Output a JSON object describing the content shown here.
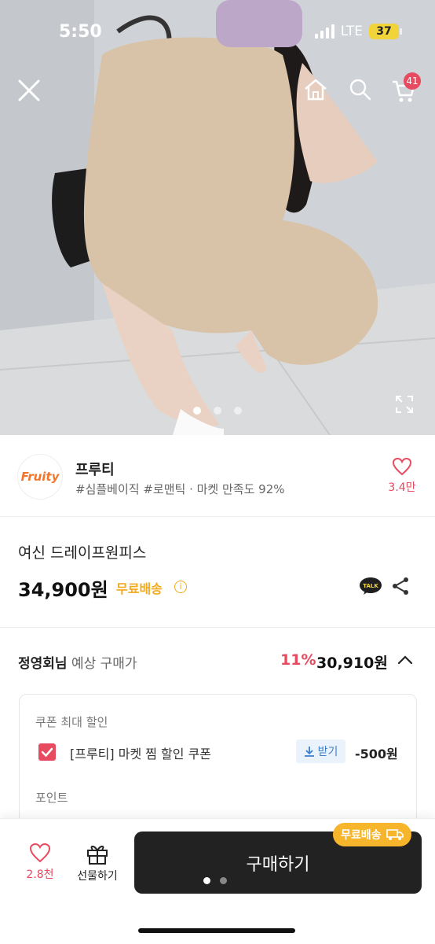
{
  "status_bar": {
    "time": "5:50",
    "network": "LTE",
    "battery": "37"
  },
  "header": {
    "cart_count": "41"
  },
  "carousel": {
    "total": 3,
    "active": 1
  },
  "shop": {
    "logo_text": "Fruity",
    "name": "프루티",
    "tags": "#심플베이직 #로맨틱 · 마켓 만족도 92%",
    "likes": "3.4만"
  },
  "product": {
    "title": "여신 드레이프원피스",
    "price": "34,900원",
    "shipping": "무료배송"
  },
  "member_price": {
    "name": "정영회님",
    "label": "예상 구매가",
    "discount": "11%",
    "price": "30,910원"
  },
  "coupon": {
    "header": "쿠폰 최대 할인",
    "item_text": "[프루티] 마켓 찜 할인 쿠폰",
    "download_label": "받기",
    "amount": "-500원",
    "points_header": "포인트"
  },
  "bottom_bar": {
    "wish_count": "2.8천",
    "gift_label": "선물하기",
    "buy_label": "구매하기",
    "free_shipping_tag": "무료배송"
  },
  "colors": {
    "accent": "#e84a5f",
    "shipping": "#f2a91c",
    "button": "#222222"
  }
}
